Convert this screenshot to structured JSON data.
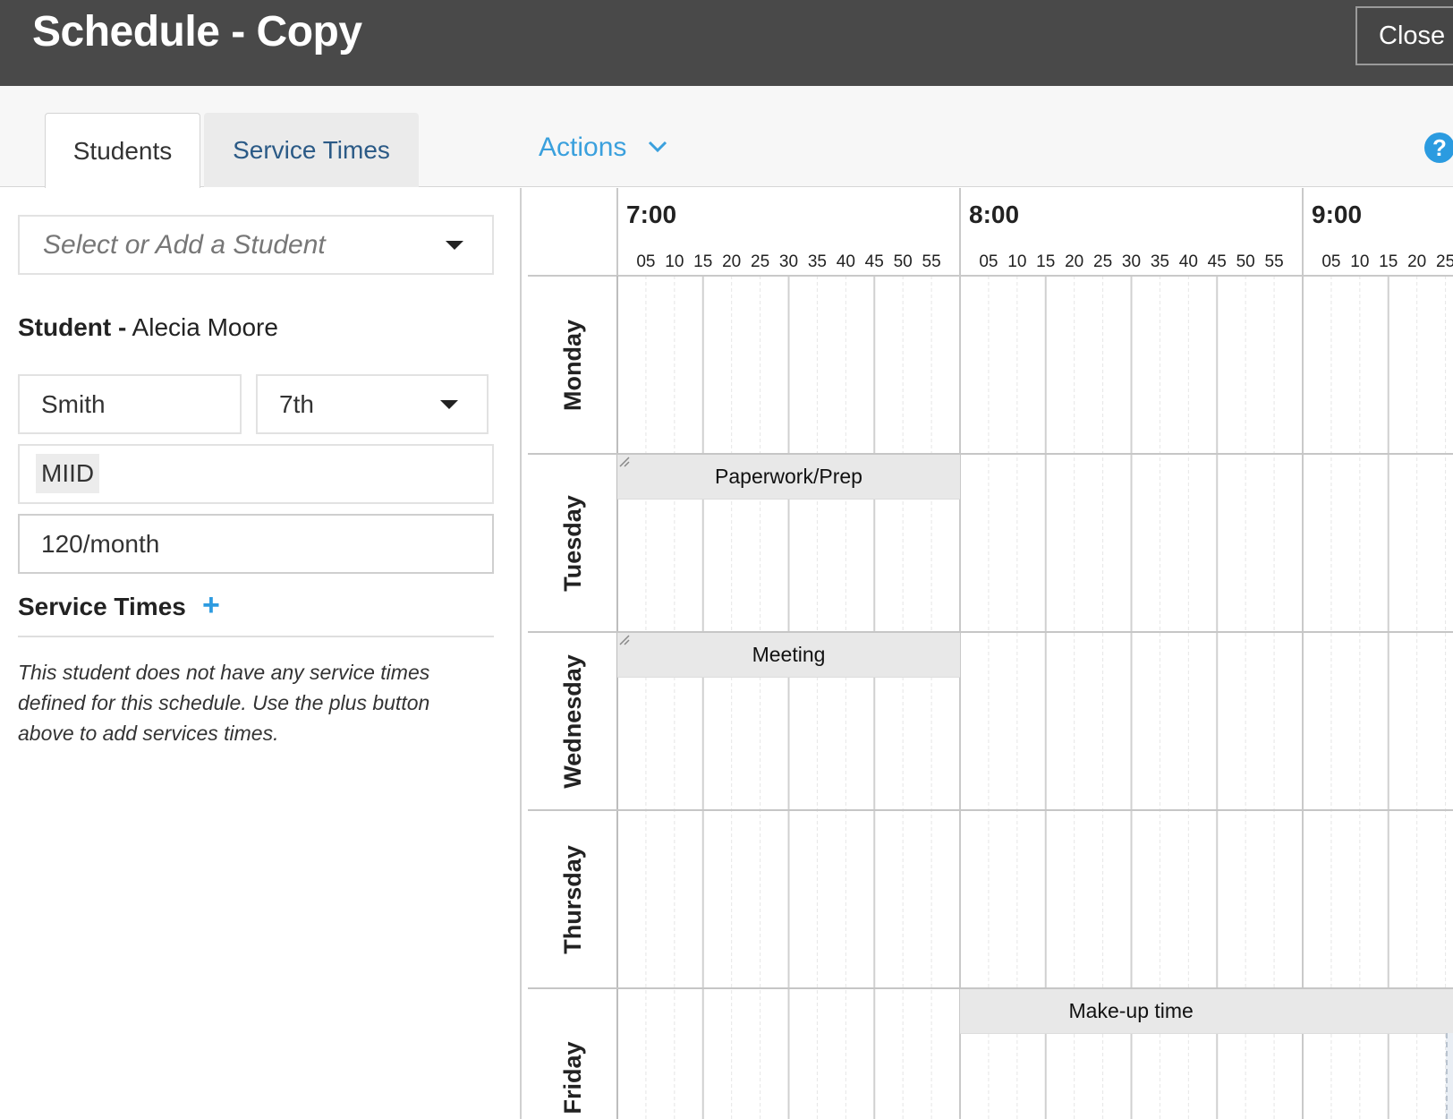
{
  "window": {
    "title": "Schedule - Copy",
    "close_label": "Close"
  },
  "tabs": [
    {
      "label": "Students",
      "active": true
    },
    {
      "label": "Service Times",
      "active": false
    }
  ],
  "actions_label": "Actions",
  "help_icon": "?",
  "student_panel": {
    "select_placeholder": "Select or Add a Student",
    "student_label": "Student -",
    "student_name": "Alecia Moore",
    "last_name": "Smith",
    "grade": "7th",
    "category": "MIID",
    "frequency": "120/month",
    "service_times_heading": "Service Times",
    "add_icon": "+",
    "no_services_note": "This student does not have any service times defined for this schedule. Use the plus button above to add services times."
  },
  "schedule": {
    "hours": [
      "7:00",
      "8:00",
      "9:00"
    ],
    "minutes": [
      "05",
      "10",
      "15",
      "20",
      "25",
      "30",
      "35",
      "40",
      "45",
      "50",
      "55"
    ],
    "days": [
      "Monday",
      "Tuesday",
      "Wednesday",
      "Thursday",
      "Friday"
    ],
    "events": [
      {
        "day": "Tuesday",
        "label": "Paperwork/Prep",
        "start": "7:00",
        "end": "8:00"
      },
      {
        "day": "Wednesday",
        "label": "Meeting",
        "start": "7:00",
        "end": "8:00"
      },
      {
        "day": "Friday",
        "label": "Make-up time",
        "start": "8:00",
        "end": "9:00+"
      }
    ]
  },
  "colors": {
    "titlebar": "#494949",
    "accent": "#3aa0dd",
    "tab_link": "#2b5a86",
    "event_bg": "#e8e8e8"
  }
}
